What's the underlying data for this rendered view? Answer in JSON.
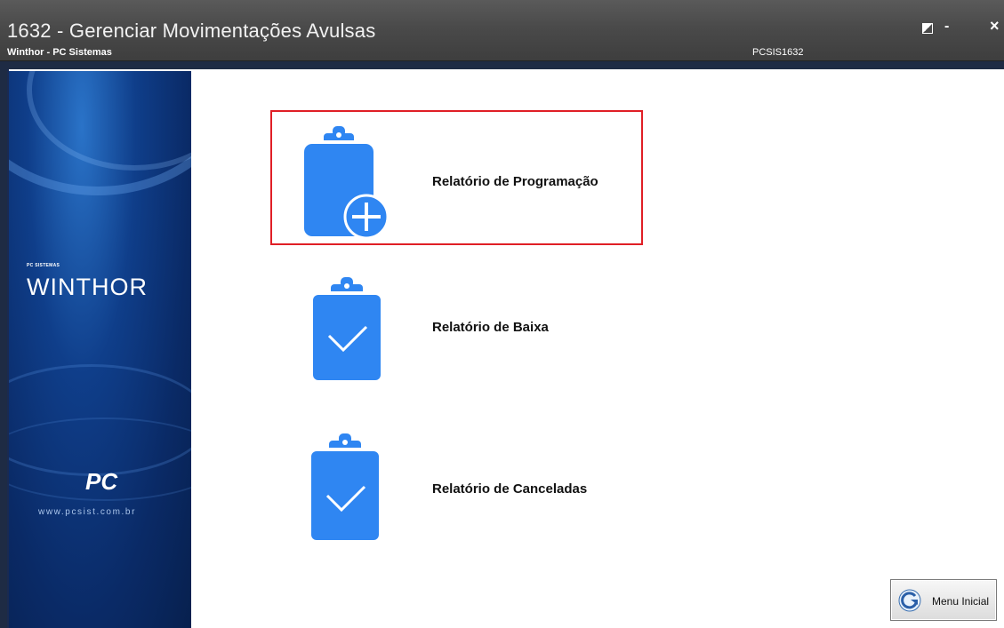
{
  "window": {
    "title": "1632 - Gerenciar Movimentações Avulsas",
    "subtitle": "Winthor - PC Sistemas",
    "program_code": "PCSIS1632",
    "controls": {
      "minimize": "-",
      "close": "×"
    }
  },
  "sidepanel": {
    "brand_small": "PC SISTEMAS",
    "brand": "WINTHOR",
    "company_logo": "PC",
    "website": "www.pcsist.com.br"
  },
  "reports": [
    {
      "label": "Relatório de Programação",
      "icon": "clipboard-plus-icon",
      "selected": true
    },
    {
      "label": "Relatório de Baixa",
      "icon": "clipboard-check-icon",
      "selected": false
    },
    {
      "label": "Relatório de Canceladas",
      "icon": "clipboard-check-icon",
      "selected": false
    }
  ],
  "footer": {
    "menu_button_label": "Menu Inicial",
    "menu_button_icon": "back-arrow-icon"
  },
  "colors": {
    "icon_blue": "#2f86f2",
    "highlight_red": "#e01f26"
  }
}
